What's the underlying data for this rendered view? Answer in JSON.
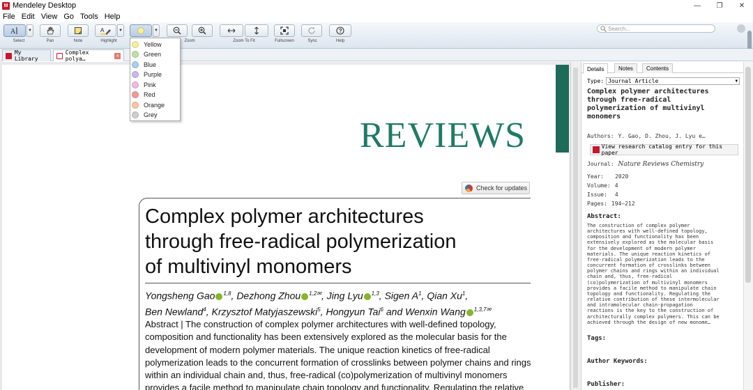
{
  "window": {
    "title": "Mendeley Desktop",
    "logo": "M"
  },
  "menu": [
    "File",
    "Edit",
    "View",
    "Go",
    "Tools",
    "Help"
  ],
  "toolbar": {
    "select": "Select",
    "pan": "Pan",
    "note": "Note",
    "highlight": "Highlight",
    "zoom": "Zoom",
    "zoom_to_fit": "Zoom To Fit",
    "fullscreen": "Fullscreen",
    "sync": "Sync",
    "help": "Help",
    "search_placeholder": "Search..."
  },
  "tabs": {
    "library": "My Library",
    "document": "Complex polya…"
  },
  "highlight_colors": [
    {
      "label": "Yellow",
      "color": "#f7ef9a"
    },
    {
      "label": "Green",
      "color": "#b9e3a4"
    },
    {
      "label": "Blue",
      "color": "#a9cff0"
    },
    {
      "label": "Purple",
      "color": "#c9b8ee"
    },
    {
      "label": "Pink",
      "color": "#f2b8e8"
    },
    {
      "label": "Red",
      "color": "#f29a9a"
    },
    {
      "label": "Orange",
      "color": "#f7c89a"
    },
    {
      "label": "Grey",
      "color": "#cfcfcf"
    }
  ],
  "paper": {
    "journal_wordmark": "REVIEWS",
    "check_updates": "Check for updates",
    "title_lines": [
      "Complex polymer architectures",
      "through free-radical polymerization",
      "of multivinyl monomers"
    ],
    "authors_line1": [
      {
        "name": "Yongsheng Gao",
        "orcid": true,
        "sup": "1,8"
      },
      {
        "name": ", Dezhong Zhou",
        "orcid": true,
        "sup": "1,2✉"
      },
      {
        "name": ", Jing Lyu",
        "orcid": true,
        "sup": "1,3"
      },
      {
        "name": ", Sigen A",
        "orcid": false,
        "sup": "1"
      },
      {
        "name": ", Qian Xu",
        "orcid": false,
        "sup": "1"
      },
      {
        "name": ",",
        "orcid": false,
        "sup": ""
      }
    ],
    "authors_line2": [
      {
        "name": "Ben Newland",
        "orcid": false,
        "sup": "4"
      },
      {
        "name": ", Krzysztof Matyjaszewski",
        "orcid": false,
        "sup": "5"
      },
      {
        "name": ", Hongyun Tai",
        "orcid": false,
        "sup": "6"
      },
      {
        "name": " and Wenxin Wang",
        "orcid": true,
        "sup": "1,3,7✉"
      }
    ],
    "abstract_lines": [
      "Abstract | The construction of complex polymer architectures with well-defined topology,",
      "composition and functionality has been extensively explored as the molecular basis for the",
      "development of modern polymer materials. The unique reaction kinetics of free-radical",
      "polymerization leads to the concurrent formation of crosslinks between polymer chains and rings",
      "within an individual chain and, thus, free-radical (co)polymerization of multivinyl monomers",
      "provides a facile method to manipulate chain topology and functionality. Regulating the relative"
    ]
  },
  "details": {
    "tabs": [
      "Details",
      "Notes",
      "Contents"
    ],
    "type_label": "Type:",
    "type_value": "Journal Article",
    "title_lines": [
      "Complex polymer architectures",
      "through free-radical",
      "polymerization of multivinyl",
      "monomers"
    ],
    "authors_label": "Authors:",
    "authors_value": "Y. Gao,  D. Zhou,  J. Lyu e…",
    "catalog_link": "View research catalog entry for this paper",
    "journal_label": "Journal:",
    "journal_value": "Nature Reviews Chemistry",
    "year_label": "Year:",
    "year_value": "2020",
    "volume_label": "Volume:",
    "volume_value": "4",
    "issue_label": "Issue:",
    "issue_value": "4",
    "pages_label": "Pages:",
    "pages_value": "194–212",
    "abstract_head": "Abstract:",
    "abstract_lines": [
      "The construction of complex polymer",
      "architectures with well-defined topology,",
      "composition and functionality has been",
      "extensively explored as the molecular basis",
      "for the development of modern polymer",
      "materials. The unique reaction kinetics of",
      "free-radical polymerization leads to the",
      "concurrent formation of crosslinks between",
      "polymer chains and rings within an individual",
      "chain and, thus, free-radical",
      "(co)polymerization of multivinyl monomers",
      "provides a facile method to manipulate chain",
      "topology and functionality. Regulating the",
      "relative contribution of these intermolecular",
      "and intramolecular chain-propagation",
      "reactions is the key to the construction of",
      "architecturally complex polymers. This can be",
      "achieved through the design of new monome…"
    ],
    "tags_head": "Tags:",
    "keywords_head": "Author Keywords:",
    "publisher_head": "Publisher:"
  }
}
